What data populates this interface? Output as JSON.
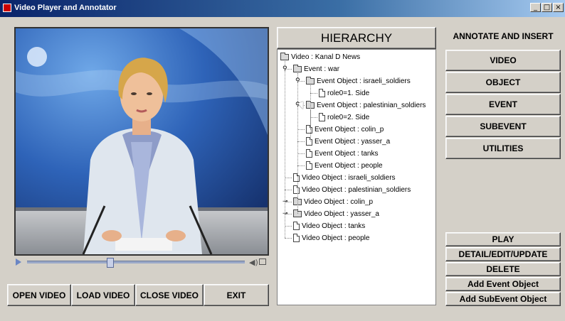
{
  "window": {
    "title": "Video Player and Annotator",
    "controls": {
      "minimize": "_",
      "maximize": "□",
      "close": "×"
    }
  },
  "player": {
    "progress_fraction": 0.38,
    "icons": [
      "play-icon",
      "volume-icon",
      "fullscreen-icon"
    ]
  },
  "bottom_buttons": {
    "open_video": "OPEN VIDEO",
    "load_video": "LOAD VIDEO",
    "close_video": "CLOSE VIDEO",
    "exit": "EXIT"
  },
  "hierarchy": {
    "header": "HIERARCHY",
    "nodes": [
      {
        "text": "Video : Kanal D News",
        "icon": "folder",
        "level": 0,
        "toggle": ""
      },
      {
        "text": "Event : war",
        "icon": "folder",
        "level": 1,
        "toggle": "⚲"
      },
      {
        "text": "Event Object : israeli_soldiers",
        "icon": "folder",
        "level": 2,
        "toggle": "⚲"
      },
      {
        "text": "role0=1. Side",
        "icon": "file",
        "level": 3,
        "toggle": ""
      },
      {
        "text": "Event Object : palestinian_soldiers",
        "icon": "folder",
        "level": 2,
        "toggle": "⚲"
      },
      {
        "text": "role0=2. Side",
        "icon": "file",
        "level": 3,
        "toggle": ""
      },
      {
        "text": "Event Object : colin_p",
        "icon": "file",
        "level": 2,
        "toggle": ""
      },
      {
        "text": "Event Object : yasser_a",
        "icon": "file",
        "level": 2,
        "toggle": ""
      },
      {
        "text": "Event Object : tanks",
        "icon": "file",
        "level": 2,
        "toggle": ""
      },
      {
        "text": "Event Object : people",
        "icon": "file",
        "level": 2,
        "toggle": ""
      },
      {
        "text": "Video Object : israeli_soldiers",
        "icon": "file",
        "level": 1,
        "toggle": ""
      },
      {
        "text": "Video Object : palestinian_soldiers",
        "icon": "file",
        "level": 1,
        "toggle": ""
      },
      {
        "text": "Video Object : colin_p",
        "icon": "folder",
        "level": 1,
        "toggle": "⊸"
      },
      {
        "text": "Video Object : yasser_a",
        "icon": "folder",
        "level": 1,
        "toggle": "⊸"
      },
      {
        "text": "Video Object : tanks",
        "icon": "file",
        "level": 1,
        "toggle": ""
      },
      {
        "text": "Video Object : people",
        "icon": "file",
        "level": 1,
        "toggle": ""
      }
    ]
  },
  "annotate": {
    "title": "ANNOTATE AND INSERT",
    "buttons": [
      "VIDEO",
      "OBJECT",
      "EVENT",
      "SUBEVENT",
      "UTILITIES"
    ]
  },
  "actions": {
    "buttons": [
      "PLAY",
      "DETAIL/EDIT/UPDATE",
      "DELETE",
      "Add Event Object",
      "Add SubEvent Object"
    ]
  },
  "colors": {
    "window_bg": "#d4d0c8",
    "titlebar_start": "#0a246a",
    "titlebar_end": "#a6caf0",
    "tree_bg": "#ffffff"
  }
}
